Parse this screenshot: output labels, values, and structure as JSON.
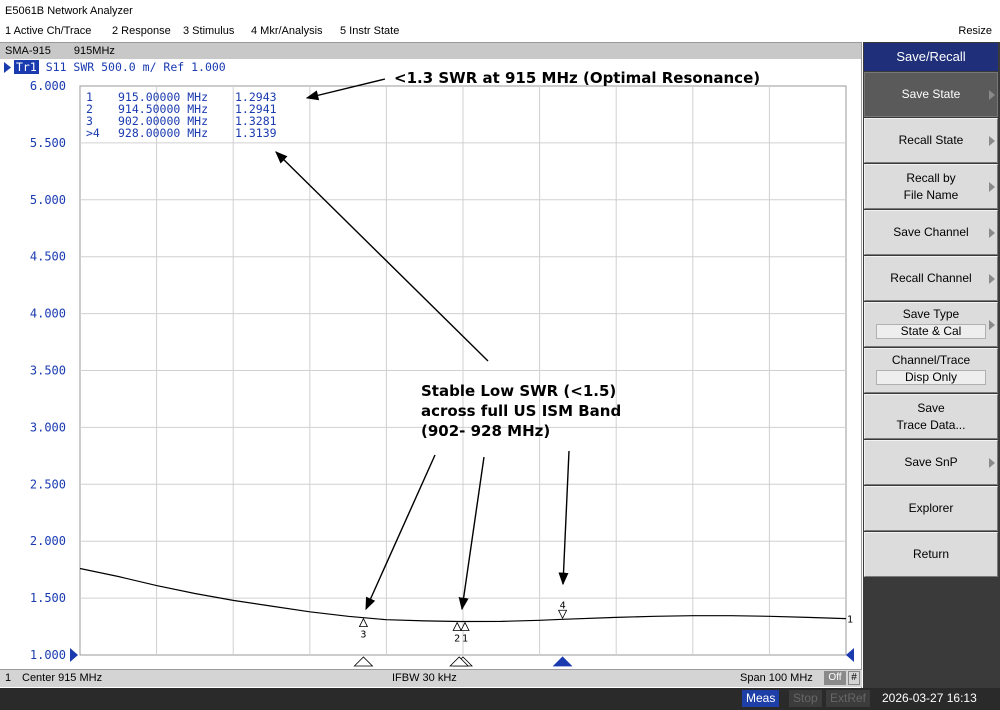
{
  "window": {
    "title": "E5061B Network Analyzer"
  },
  "menu": {
    "items": [
      "1 Active Ch/Trace",
      "2 Response",
      "3 Stimulus",
      "4 Mkr/Analysis",
      "5 Instr State"
    ],
    "resize": "Resize"
  },
  "channel": {
    "name": "SMA-915",
    "freq": "915MHz"
  },
  "trace": {
    "id": "Tr1",
    "desc": "S11  SWR 500.0 m/ Ref 1.000"
  },
  "y_axis": {
    "labels": [
      "6.000",
      "5.500",
      "5.000",
      "4.500",
      "4.000",
      "3.500",
      "3.000",
      "2.500",
      "2.000",
      "1.500",
      "1.000"
    ]
  },
  "marker_table": [
    {
      "num": "1",
      "freq": "915.00000 MHz",
      "value": "1.2943"
    },
    {
      "num": "2",
      "freq": "914.50000 MHz",
      "value": "1.2941"
    },
    {
      "num": "3",
      "freq": "902.00000 MHz",
      "value": "1.3281"
    },
    {
      "num": ">4",
      "freq": "928.00000 MHz",
      "value": "1.3139"
    }
  ],
  "annotations": {
    "top": "<1.3 SWR at 915 MHz (Optimal Resonance)",
    "middle": [
      "Stable Low SWR (<1.5)",
      "across full US ISM Band",
      "(902- 928 MHz)"
    ]
  },
  "chart_data": {
    "type": "line",
    "x_unit": "MHz",
    "xlim": [
      865,
      965
    ],
    "ylim": [
      1.0,
      6.0
    ],
    "series": [
      {
        "x": [
          865,
          870,
          875,
          880,
          885,
          890,
          895,
          900,
          902,
          905,
          910,
          914.5,
          915,
          920,
          925,
          928,
          935,
          940,
          945,
          950,
          955,
          960,
          965
        ],
        "y": [
          1.76,
          1.69,
          1.61,
          1.54,
          1.48,
          1.43,
          1.38,
          1.34,
          1.328,
          1.31,
          1.3,
          1.294,
          1.294,
          1.295,
          1.305,
          1.314,
          1.33,
          1.34,
          1.345,
          1.345,
          1.34,
          1.33,
          1.32
        ]
      }
    ],
    "markers": [
      {
        "label": "1",
        "x": 915.0,
        "y": 1.2943
      },
      {
        "label": "2",
        "x": 914.5,
        "y": 1.2941
      },
      {
        "label": "3",
        "x": 902.0,
        "y": 1.3281
      },
      {
        "label": "4",
        "x": 928.0,
        "y": 1.3139
      }
    ],
    "trace_end_label": "1"
  },
  "status": {
    "channel": "1",
    "center": "Center  915 MHz",
    "ifbw": "IFBW 30 kHz",
    "span": "Span 100 MHz",
    "off": "Off",
    "num": "#"
  },
  "bottom": {
    "meas": "Meas",
    "stop": "Stop",
    "extref": "ExtRef",
    "time": "2026-03-27 16:13"
  },
  "softkeys": {
    "title": "Save/Recall",
    "items": [
      {
        "lines": [
          "Save State"
        ],
        "active": true,
        "arrow": true
      },
      {
        "lines": [
          "Recall State"
        ],
        "arrow": true
      },
      {
        "lines": [
          "Recall by",
          "File Name"
        ],
        "arrow": true
      },
      {
        "lines": [
          "Save Channel"
        ],
        "arrow": true
      },
      {
        "lines": [
          "Recall Channel"
        ],
        "arrow": true
      },
      {
        "lines": [
          "Save Type"
        ],
        "sub": "State & Cal",
        "arrow": true
      },
      {
        "lines": [
          "Channel/Trace"
        ],
        "sub": "Disp Only"
      },
      {
        "lines": [
          "Save",
          "Trace Data..."
        ]
      },
      {
        "lines": [
          "Save SnP"
        ],
        "arrow": true
      },
      {
        "lines": [
          "Explorer"
        ]
      },
      {
        "lines": [
          "Return"
        ]
      }
    ]
  },
  "colors": {
    "trace": "#000000",
    "label_blue": "#1a3bb0",
    "marker_blue": "#1a3bb0",
    "softkey_title_bg": "#1f2f7a"
  }
}
